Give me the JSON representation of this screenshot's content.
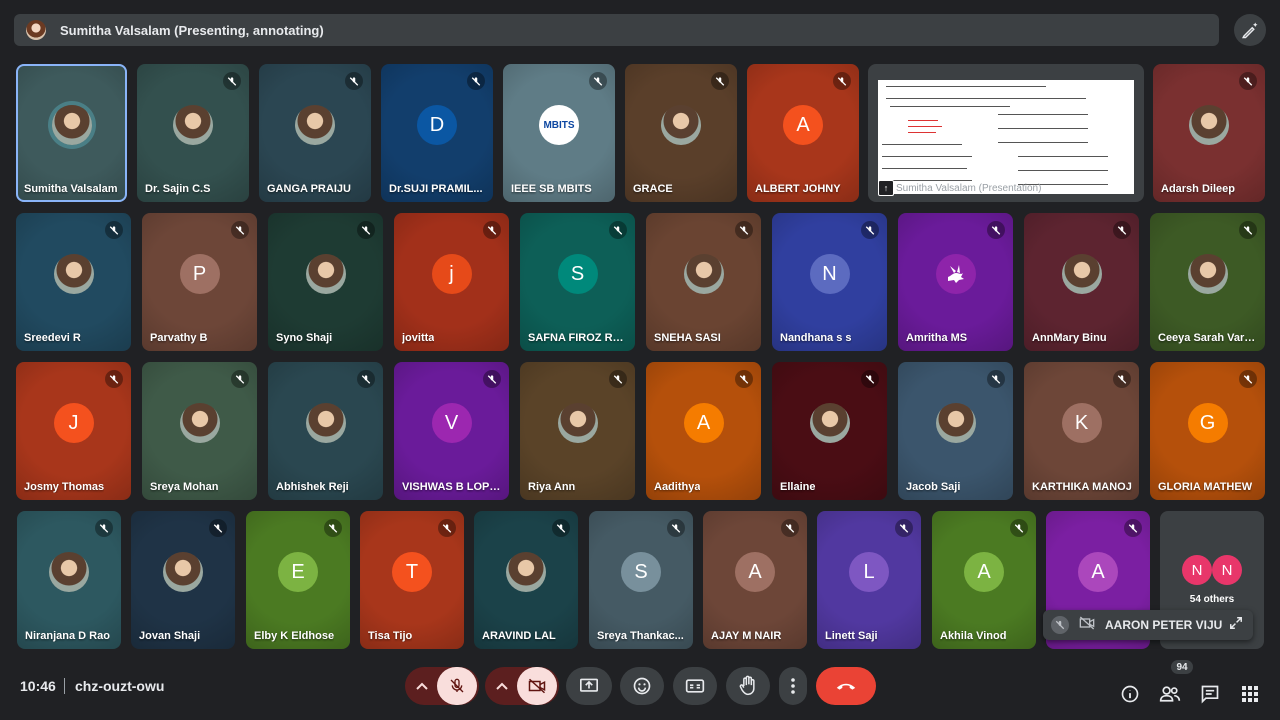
{
  "header": {
    "presenter_label": "Sumitha Valsalam (Presenting, annotating)"
  },
  "colors": {
    "background": "#202124",
    "bar": "#3c4043",
    "hangup": "#ea4335",
    "muted_button": "#f9dedc",
    "others_avatar": "#e8366a",
    "active_outline": "#8ab4f8"
  },
  "participants": [
    {
      "name": "Sumitha Valsalam",
      "kind": "photo",
      "bg": "#3e5a5c",
      "active": true,
      "muted": false
    },
    {
      "name": "Dr. Sajin C.S",
      "kind": "photo",
      "bg": "#33504e",
      "muted": true
    },
    {
      "name": "GANGA PRAIJU",
      "kind": "photo",
      "bg": "#2b4652",
      "muted": true
    },
    {
      "name": "Dr.SUJI PRAMIL...",
      "kind": "letter",
      "initial": "D",
      "circle": "#0b57a3",
      "bg": "#123e6c",
      "muted": true
    },
    {
      "name": "IEEE SB MBITS",
      "kind": "logo",
      "logo_text": "MBITS",
      "bg": "#5f7c86",
      "muted": true
    },
    {
      "name": "GRACE",
      "kind": "photo",
      "bg": "#5a3f2a",
      "muted": true
    },
    {
      "name": "ALBERT JOHNY",
      "kind": "letter",
      "initial": "A",
      "circle": "#f4511e",
      "bg": "#a8361b",
      "muted": true
    },
    {
      "name": "Adarsh Dileep",
      "kind": "photo",
      "bg": "#7a3030",
      "muted": true
    },
    {
      "name": "Sreedevi R",
      "kind": "photo",
      "bg": "#214a60",
      "muted": true
    },
    {
      "name": "Parvathy B",
      "kind": "letter",
      "initial": "P",
      "circle": "#9e7063",
      "bg": "#6d4638",
      "muted": true
    },
    {
      "name": "Syno Shaji",
      "kind": "photo",
      "bg": "#1e3b33",
      "muted": true
    },
    {
      "name": "jovitta",
      "kind": "letter",
      "initial": "j",
      "circle": "#e64a19",
      "bg": "#a2301a",
      "muted": true
    },
    {
      "name": "SAFNA FIROZ RB...",
      "kind": "letter",
      "initial": "S",
      "circle": "#00897b",
      "bg": "#0d5f57",
      "muted": true
    },
    {
      "name": "SNEHA SASI",
      "kind": "photo",
      "bg": "#6a4432",
      "muted": true
    },
    {
      "name": "Nandhana s s",
      "kind": "letter",
      "initial": "N",
      "circle": "#5c6bc0",
      "bg": "#303f9f",
      "muted": true
    },
    {
      "name": "Amritha MS",
      "kind": "icon",
      "circle": "#8e24aa",
      "bg": "#6a1b9a",
      "muted": true
    },
    {
      "name": "AnnMary Binu",
      "kind": "photo",
      "bg": "#5d2430",
      "muted": true
    },
    {
      "name": "Ceeya Sarah Varg...",
      "kind": "photo",
      "bg": "#3d5a25",
      "muted": true
    },
    {
      "name": "Josmy Thomas",
      "kind": "letter",
      "initial": "J",
      "circle": "#f4511e",
      "bg": "#a8361b",
      "muted": true
    },
    {
      "name": "Sreya Mohan",
      "kind": "photo",
      "bg": "#3f5a48",
      "muted": true
    },
    {
      "name": "Abhishek Reji",
      "kind": "photo",
      "bg": "#2a4750",
      "muted": true
    },
    {
      "name": "VISHWAS B LOPEZ",
      "kind": "letter",
      "initial": "V",
      "circle": "#9c27b0",
      "bg": "#6a1b9a",
      "muted": true
    },
    {
      "name": "Riya Ann",
      "kind": "photo",
      "bg": "#5a4328",
      "muted": true
    },
    {
      "name": "Aadithya",
      "kind": "letter",
      "initial": "A",
      "circle": "#f57c00",
      "bg": "#b5500b",
      "muted": true
    },
    {
      "name": "Ellaine",
      "kind": "photo",
      "bg": "#4a0d14",
      "muted": true
    },
    {
      "name": "Jacob Saji",
      "kind": "photo",
      "bg": "#3b556c",
      "muted": true
    },
    {
      "name": "KARTHIKA MANOJ",
      "kind": "letter",
      "initial": "K",
      "circle": "#9e7063",
      "bg": "#6d4638",
      "muted": true
    },
    {
      "name": "GLORIA MATHEW",
      "kind": "letter",
      "initial": "G",
      "circle": "#f57c00",
      "bg": "#b5500b",
      "muted": true
    },
    {
      "name": "Niranjana D Rao",
      "kind": "photo",
      "bg": "#2d5860",
      "muted": true
    },
    {
      "name": "Jovan Shaji",
      "kind": "photo",
      "bg": "#1f3346",
      "muted": true
    },
    {
      "name": "Elby K Eldhose",
      "kind": "letter",
      "initial": "E",
      "circle": "#7cb342",
      "bg": "#4b7a22",
      "muted": true
    },
    {
      "name": "Tisa Tijo",
      "kind": "letter",
      "initial": "T",
      "circle": "#f4511e",
      "bg": "#a8361b",
      "muted": true
    },
    {
      "name": "ARAVIND LAL",
      "kind": "photo",
      "bg": "#1b4249",
      "muted": true
    },
    {
      "name": "Sreya Thankac...",
      "kind": "letter",
      "initial": "S",
      "circle": "#78909c",
      "bg": "#455a64",
      "muted": true
    },
    {
      "name": "AJAY M NAIR",
      "kind": "letter",
      "initial": "A",
      "circle": "#9e7063",
      "bg": "#6d4638",
      "muted": true
    },
    {
      "name": "Linett Saji",
      "kind": "letter",
      "initial": "L",
      "circle": "#7e57c2",
      "bg": "#5138a0",
      "muted": true
    },
    {
      "name": "Akhila Vinod",
      "kind": "letter",
      "initial": "A",
      "circle": "#7cb342",
      "bg": "#4b7a22",
      "muted": true
    },
    {
      "name": "",
      "kind": "letter",
      "initial": "A",
      "circle": "#ab47bc",
      "bg": "#7b1fa2",
      "muted": true
    }
  ],
  "presentation": {
    "presenter_caption": "Sumitha Valsalam (Presentation)"
  },
  "others": {
    "initials": [
      "N",
      "N"
    ],
    "label": "54 others"
  },
  "toast": {
    "name": "AARON PETER VIJU"
  },
  "bottom": {
    "time": "10:46",
    "meeting_code": "chz-ouzt-owu",
    "people_count": "94"
  }
}
